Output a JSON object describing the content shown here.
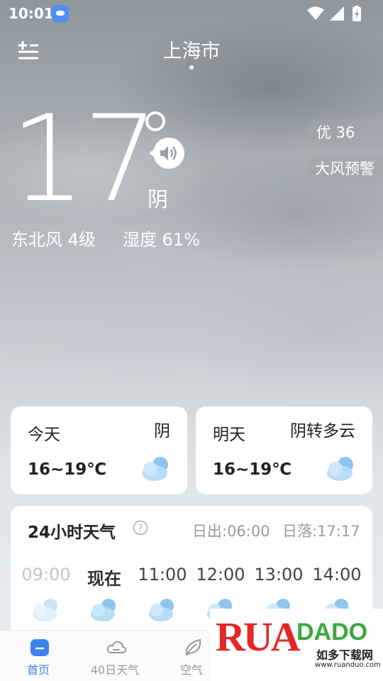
{
  "status_bar": {
    "time": "10:01",
    "icons": [
      "weather-app-notification-icon",
      "wifi-icon",
      "cellular-signal-icon",
      "battery-charging-icon"
    ]
  },
  "header": {
    "city": "上海市",
    "menu_icon": "city-manage-icon"
  },
  "current": {
    "temperature": "17",
    "condition": "阴",
    "wind": "东北风 4级",
    "humidity": "湿度 61%",
    "aqi": "优 36",
    "alert": "大风预警"
  },
  "days": [
    {
      "label": "今天",
      "condition": "阴",
      "range": "16~19℃",
      "icon": "cloudy-icon"
    },
    {
      "label": "明天",
      "condition": "阴转多云",
      "range": "16~19℃",
      "icon": "cloudy-icon"
    }
  ],
  "hourly": {
    "title": "24小时天气",
    "sunrise": "日出:06:00",
    "sunset": "日落:17:17",
    "hours": [
      {
        "label": "09:00",
        "icon": "cloudy-icon"
      },
      {
        "label": "现在",
        "icon": "cloudy-icon"
      },
      {
        "label": "11:00",
        "icon": "cloudy-icon"
      },
      {
        "label": "12:00",
        "icon": "cloudy-icon"
      },
      {
        "label": "13:00",
        "icon": "cloudy-icon"
      },
      {
        "label": "14:00",
        "icon": "cloudy-icon"
      }
    ]
  },
  "nav": [
    {
      "label": "首页",
      "icon": "home-icon",
      "active": true
    },
    {
      "label": "40日天气",
      "icon": "cloud-forecast-icon",
      "active": false
    },
    {
      "label": "空气",
      "icon": "leaf-icon",
      "active": false
    }
  ],
  "watermark": {
    "brand": "RUANDADO",
    "name_cn": "如多下载网",
    "url": "www.ruanduo.com"
  },
  "colors": {
    "accent": "#3d82ef",
    "card_bg": "#ffffff",
    "sky_top": "#8f979d",
    "sky_bottom": "#e9edf0"
  }
}
